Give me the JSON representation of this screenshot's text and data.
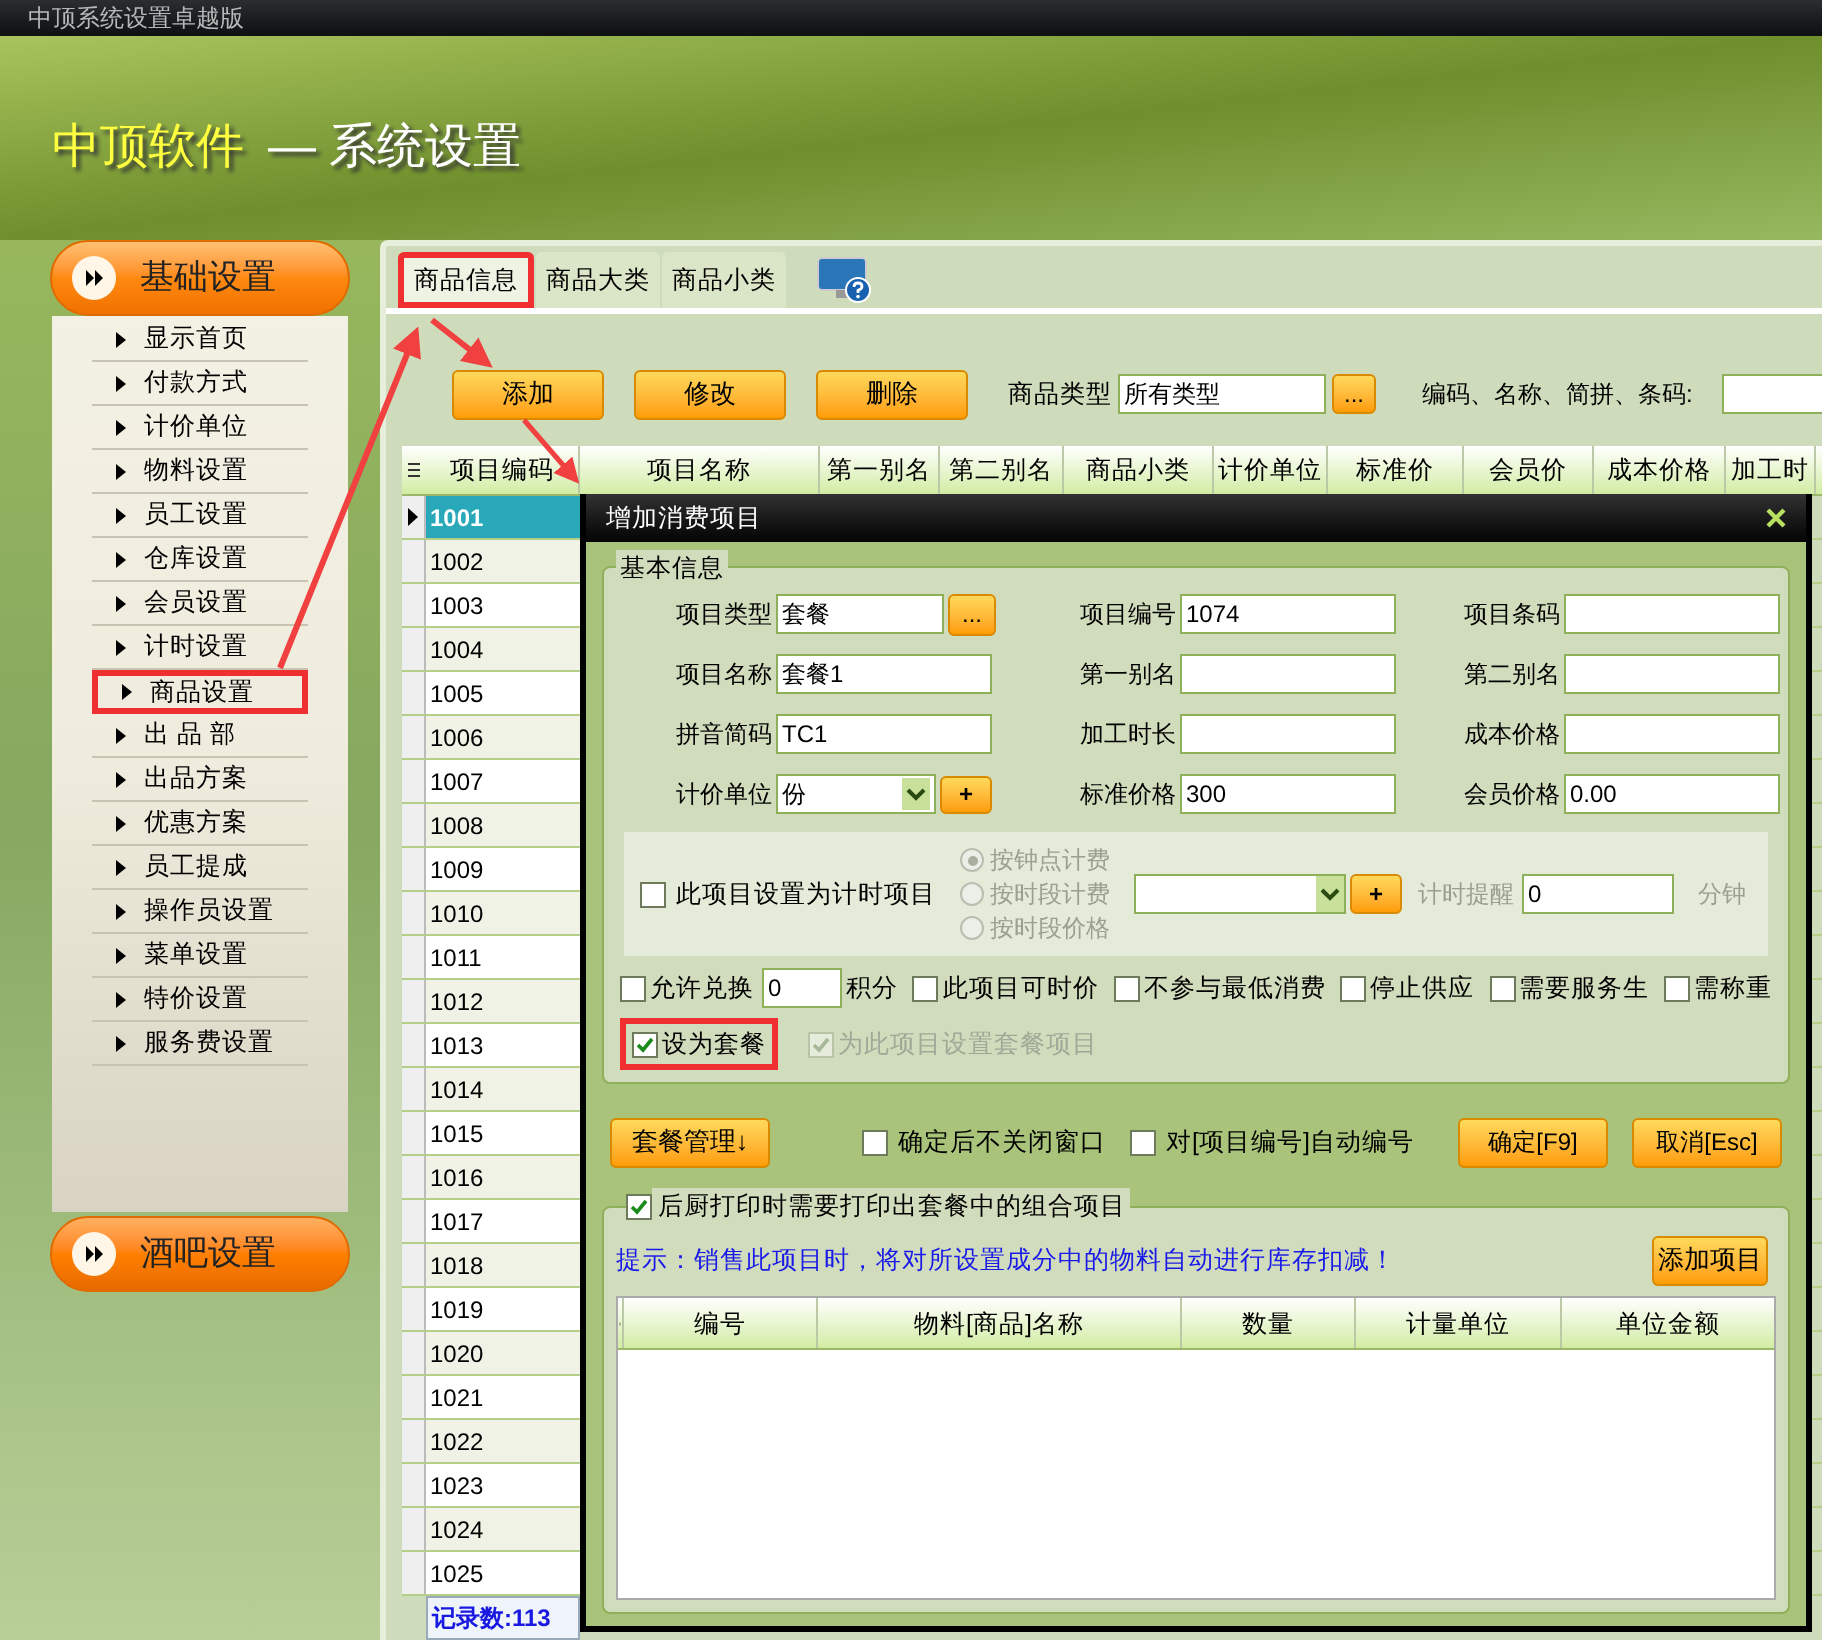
{
  "window": {
    "title": "中顶系统设置卓越版"
  },
  "header": {
    "brand": "中顶软件",
    "title": "— 系统设置"
  },
  "sidebar": {
    "groups": [
      {
        "label": "基础设置",
        "expanded": true,
        "items": [
          {
            "label": "显示首页",
            "highlighted": false
          },
          {
            "label": "付款方式",
            "highlighted": false
          },
          {
            "label": "计价单位",
            "highlighted": false
          },
          {
            "label": "物料设置",
            "highlighted": false
          },
          {
            "label": "员工设置",
            "highlighted": false
          },
          {
            "label": "仓库设置",
            "highlighted": false
          },
          {
            "label": "会员设置",
            "highlighted": false
          },
          {
            "label": "计时设置",
            "highlighted": false
          },
          {
            "label": "商品设置",
            "highlighted": true
          },
          {
            "label": "出 品 部",
            "highlighted": false
          },
          {
            "label": "出品方案",
            "highlighted": false
          },
          {
            "label": "优惠方案",
            "highlighted": false
          },
          {
            "label": "员工提成",
            "highlighted": false
          },
          {
            "label": "操作员设置",
            "highlighted": false
          },
          {
            "label": "菜单设置",
            "highlighted": false
          },
          {
            "label": "特价设置",
            "highlighted": false
          },
          {
            "label": "服务费设置",
            "highlighted": false
          }
        ]
      },
      {
        "label": "酒吧设置",
        "expanded": false
      }
    ]
  },
  "tabs": [
    {
      "label": "商品信息",
      "selected": true,
      "highlighted": true
    },
    {
      "label": "商品大类",
      "selected": false,
      "highlighted": false
    },
    {
      "label": "商品小类",
      "selected": false,
      "highlighted": false
    }
  ],
  "toolbar": {
    "buttons": [
      "添加",
      "修改",
      "删除"
    ],
    "type_filter": {
      "label": "商品类型",
      "value": "所有类型",
      "button": "..."
    },
    "search": {
      "label": "编码、名称、简拼、条码:"
    }
  },
  "table": {
    "columns": [
      "项目编码",
      "项目名称",
      "第一别名",
      "第二别名",
      "商品小类",
      "计价单位",
      "标准价",
      "会员价",
      "成本价格",
      "加工时"
    ],
    "rows": [
      {
        "code": "1001",
        "selected": true
      },
      {
        "code": "1002",
        "selected": false
      },
      {
        "code": "1003",
        "selected": false
      },
      {
        "code": "1004",
        "selected": false
      },
      {
        "code": "1005",
        "selected": false
      },
      {
        "code": "1006",
        "selected": false
      },
      {
        "code": "1007",
        "selected": false
      },
      {
        "code": "1008",
        "selected": false
      },
      {
        "code": "1009",
        "selected": false
      },
      {
        "code": "1010",
        "selected": false
      },
      {
        "code": "1011",
        "selected": false
      },
      {
        "code": "1012",
        "selected": false
      },
      {
        "code": "1013",
        "selected": false
      },
      {
        "code": "1014",
        "selected": false
      },
      {
        "code": "1015",
        "selected": false
      },
      {
        "code": "1016",
        "selected": false
      },
      {
        "code": "1017",
        "selected": false
      },
      {
        "code": "1018",
        "selected": false
      },
      {
        "code": "1019",
        "selected": false
      },
      {
        "code": "1020",
        "selected": false
      },
      {
        "code": "1021",
        "selected": false
      },
      {
        "code": "1022",
        "selected": false
      },
      {
        "code": "1023",
        "selected": false
      },
      {
        "code": "1024",
        "selected": false
      },
      {
        "code": "1025",
        "selected": false
      }
    ],
    "record_count": "记录数:113"
  },
  "dialog": {
    "title": "增加消费项目",
    "legend": "基本信息",
    "fields": [
      {
        "kind": "picker",
        "label": "项目类型",
        "value": "套餐",
        "button": "..."
      },
      {
        "kind": "text",
        "label": "项目编号",
        "value": "1074"
      },
      {
        "kind": "text",
        "label": "项目条码"
      },
      {
        "kind": "text",
        "label": "项目名称",
        "value": "套餐1"
      },
      {
        "kind": "text",
        "label": "第一别名"
      },
      {
        "kind": "text",
        "label": "第二别名"
      },
      {
        "kind": "text",
        "label": "拼音简码",
        "value": "TC1"
      },
      {
        "kind": "text",
        "label": "加工时长"
      },
      {
        "kind": "text",
        "label": "成本价格"
      },
      {
        "kind": "select",
        "label": "计价单位",
        "value": "份",
        "button": "+"
      },
      {
        "kind": "text",
        "label": "标准价格",
        "value": "300"
      },
      {
        "kind": "text",
        "label": "会员价格",
        "value": "0.00"
      }
    ],
    "timing": {
      "label": "此项目设置为计时项目",
      "checked": false,
      "enabled": false,
      "modes": [
        {
          "label": "按钟点计费",
          "selected": true
        },
        {
          "label": "按时段计费",
          "selected": false
        },
        {
          "label": "按时段价格",
          "selected": false
        }
      ],
      "add_button": "+",
      "reminder": {
        "label": "计时提醒",
        "value": "0",
        "unit": "分钟"
      }
    },
    "options": [
      {
        "kind": "checkbox_input",
        "label": "允许兑换",
        "checked": false,
        "value": "0",
        "unit": "积分"
      },
      {
        "kind": "checkbox",
        "label": "此项目可时价",
        "checked": false
      },
      {
        "kind": "checkbox",
        "label": "不参与最低消费",
        "checked": false
      },
      {
        "kind": "checkbox",
        "label": "停止供应",
        "checked": false
      },
      {
        "kind": "checkbox",
        "label": "需要服务生",
        "checked": false
      },
      {
        "kind": "checkbox",
        "label": "需称重",
        "checked": false
      }
    ],
    "package": [
      {
        "label": "设为套餐",
        "checked": true,
        "disabled": false,
        "highlighted": true
      },
      {
        "label": "为此项目设置套餐项目",
        "checked": true,
        "disabled": true,
        "highlighted": false
      }
    ],
    "menu_button": "套餐管理↓",
    "action_checkboxes": [
      {
        "label": "确定后不关闭窗口",
        "checked": false
      },
      {
        "label": "对[项目编号]自动编号",
        "checked": false
      }
    ],
    "buttons": [
      "确定[F9]",
      "取消[Esc]"
    ],
    "components": {
      "label": "后厨打印时需要打印出套餐中的组合项目",
      "checked": true,
      "hint": "提示：销售此项目时，将对所设置成分中的物料自动进行库存扣减！",
      "add_button": "添加项目",
      "columns": [
        "编号",
        "物料[商品]名称",
        "数量",
        "计量单位",
        "单位金额"
      ]
    }
  }
}
